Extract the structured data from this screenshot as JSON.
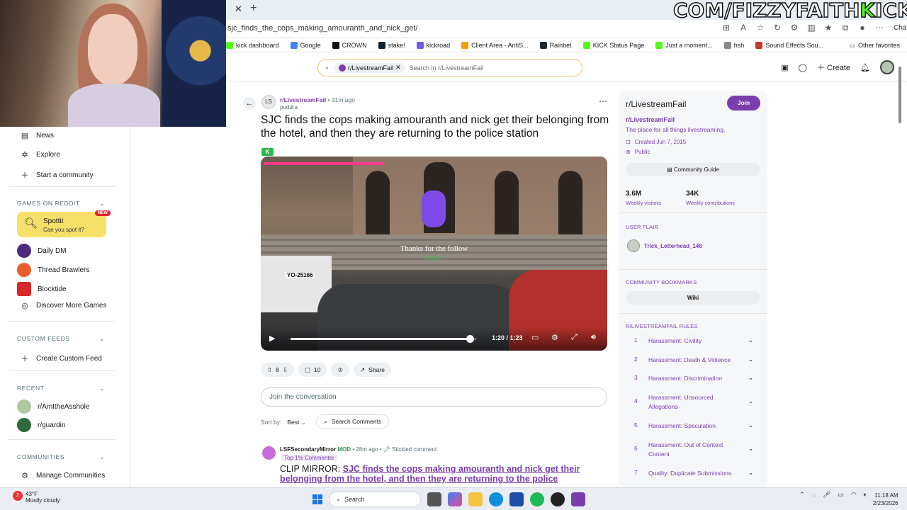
{
  "browser": {
    "url": "sjc_finds_the_cops_making_amouranth_and_nick_get/",
    "overlay_text_prefix": "COM/FIZZYFAITH",
    "overlay_text_k": "K",
    "overlay_text_suffix": "ICK.C",
    "chat_label": "Chat",
    "bookmarks": [
      {
        "label": "kick dashboard",
        "color": "#53fc18"
      },
      {
        "label": "Google",
        "color": "#4285f4"
      },
      {
        "label": "CROWN",
        "color": "#111111"
      },
      {
        "label": "stake!",
        "color": "#0f212e"
      },
      {
        "label": "kickroad",
        "color": "#6c5ce7"
      },
      {
        "label": "Client Area - AntiS...",
        "color": "#f39c12"
      },
      {
        "label": "Rainbet",
        "color": "#1e272e"
      },
      {
        "label": "KICK Status Page",
        "color": "#53fc18"
      },
      {
        "label": "Just a moment...",
        "color": "#53fc18"
      },
      {
        "label": "hsh",
        "color": "#888888"
      },
      {
        "label": "Sound Effects Sou...",
        "color": "#c0392b"
      }
    ],
    "other_favorites": "Other favorites"
  },
  "header": {
    "search_chip": "r/LivestreamFail",
    "search_placeholder": "Search in r/LivestreamFail",
    "create_label": "Create"
  },
  "sidebar": {
    "nav": [
      {
        "label": "News",
        "icon": "news-icon"
      },
      {
        "label": "Explore",
        "icon": "explore-icon"
      },
      {
        "label": "Start a community",
        "icon": "plus-icon"
      }
    ],
    "games_section": "GAMES ON REDDIT",
    "spottit_title": "Spottit",
    "spottit_sub": "Can you spot it?",
    "spottit_badge": "NEW",
    "games": [
      {
        "label": "Daily DM",
        "color": "#4b2b7f"
      },
      {
        "label": "Thread Brawlers",
        "color": "#e85d2f"
      },
      {
        "label": "Blocktide",
        "color": "#d62828"
      },
      {
        "label": "Discover More Games",
        "color": ""
      }
    ],
    "custom_feeds_section": "CUSTOM FEEDS",
    "create_custom_feed": "Create Custom Feed",
    "recent_section": "RECENT",
    "recent": [
      {
        "label": "r/AmItheAsshole",
        "color": "#b0c8a0"
      },
      {
        "label": "r/guardin",
        "color": "#2f6b3a"
      }
    ],
    "communities_section": "COMMUNITIES",
    "manage_communities": "Manage Communities"
  },
  "post": {
    "subreddit": "r/LivestreamFail",
    "time": "• 31m ago",
    "author": "puddra",
    "avatar_text": "LS",
    "title": "SJC finds the cops making amouranth and nick get their belonging from the hotel, and then they are returning to the police station",
    "flair": "K",
    "video": {
      "plate": "YO-25166",
      "overlay_follow": "Thanks for the follow",
      "overlay_name": "Newlyn",
      "time": "1:20 / 1:23",
      "progress": 0.9639
    },
    "upvotes": "8",
    "comments": "10",
    "share": "Share",
    "join_conversation": "Join the conversation",
    "sort_by_label": "Sort by:",
    "sort_by_value": "Best",
    "search_comments": "Search Comments"
  },
  "comment": {
    "user": "LSFSecondaryMirror",
    "mod": "MOD",
    "time": "• 28m ago •",
    "stickied": "Stickied comment",
    "badge": "Top 1% Commenter",
    "prefix": "CLIP MIRROR: ",
    "link": "SJC finds the cops making amouranth and nick get their belonging from the hotel, and then they are returning to the police"
  },
  "community": {
    "title": "r/LivestreamFail",
    "join": "Join",
    "name": "r/LivestreamFail",
    "description": "The place for all things livestreaming.",
    "created": "Created Jun 7, 2015",
    "visibility": "Public",
    "guide": "Community Guide",
    "visitors": "3.6M",
    "visitors_label": "Weekly visitors",
    "contributions": "34K",
    "contributions_label": "Weekly contributions",
    "user_flair_section": "USER FLAIR",
    "user_flair_name": "Trick_Letterhead_146",
    "bookmarks_section": "COMMUNITY BOOKMARKS",
    "wiki": "Wiki",
    "rules_section": "R/LIVESTREAMFAIL RULES",
    "rules": [
      {
        "num": "1",
        "text": "Harassment: Civility"
      },
      {
        "num": "2",
        "text": "Harassment: Death & Violence"
      },
      {
        "num": "3",
        "text": "Harassment: Discrimination"
      },
      {
        "num": "4",
        "text": "Harassment: Unsourced Allegations"
      },
      {
        "num": "5",
        "text": "Harassment: Speculation"
      },
      {
        "num": "6",
        "text": "Harassment: Out of Context Content"
      },
      {
        "num": "7",
        "text": "Quality: Duplicate Submissions"
      }
    ]
  },
  "taskbar": {
    "notification_count": "2",
    "temperature": "43°F",
    "weather": "Mostly cloudy",
    "search": "Search",
    "time": "11:18 AM",
    "date": "2/23/2026"
  }
}
